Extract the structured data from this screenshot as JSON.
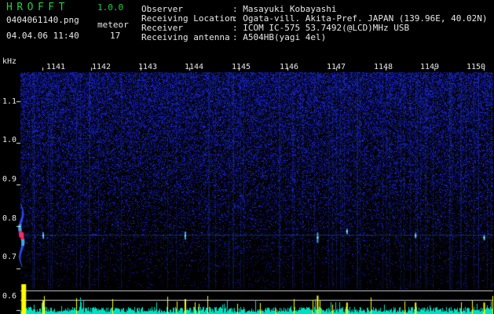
{
  "header": {
    "app_title": "HROFFT",
    "version": "1.0.0",
    "filename": "0404061140.png",
    "detection_label": "meteor",
    "datetime": "04.04.06 11:40",
    "meteor_count": "17",
    "fields": [
      {
        "label": "Observer",
        "value": ": Masayuki Kobayashi"
      },
      {
        "label": "Receiving Location",
        "value": ": Ogata-vill. Akita-Pref. JAPAN (139.96E, 40.02N)"
      },
      {
        "label": "Receiver",
        "value": ": ICOM IC-575 53.7492(@LCD)MHz USB"
      },
      {
        "label": "Receiving antenna",
        "value": ": A504HB(yagi 4el)"
      }
    ]
  },
  "colors": {
    "background": "#000000",
    "text": "#e8e8e8",
    "title": "#22d040",
    "spectrum_noise": "#1a2aa8",
    "echo_core": "#ff2a6a",
    "level_trace": "#00e0c0",
    "level_peak": "#ffff00"
  },
  "chart_data": {
    "type": "heatmap",
    "ylabel": "kHz",
    "y_ticks": [
      "1.1",
      "1.0",
      "0.9",
      "0.8",
      "0.7",
      "0.6"
    ],
    "x_ticks": [
      "1141",
      "1142",
      "1143",
      "1144",
      "1145",
      "1146",
      "1147",
      "1148",
      "1149",
      "1150"
    ],
    "ylim": [
      0.59,
      1.17
    ],
    "xlim": [
      1140.55,
      1150.2
    ],
    "echoes": [
      {
        "t": 1140.57,
        "f": 0.78,
        "strength": 1.0
      },
      {
        "t": 1141.0,
        "f": 0.78,
        "strength": 0.4
      },
      {
        "t": 1143.9,
        "f": 0.78,
        "strength": 0.5
      },
      {
        "t": 1146.6,
        "f": 0.775,
        "strength": 0.7
      },
      {
        "t": 1147.2,
        "f": 0.79,
        "strength": 0.3
      },
      {
        "t": 1148.6,
        "f": 0.78,
        "strength": 0.3
      },
      {
        "t": 1150.0,
        "f": 0.775,
        "strength": 0.3
      }
    ]
  }
}
